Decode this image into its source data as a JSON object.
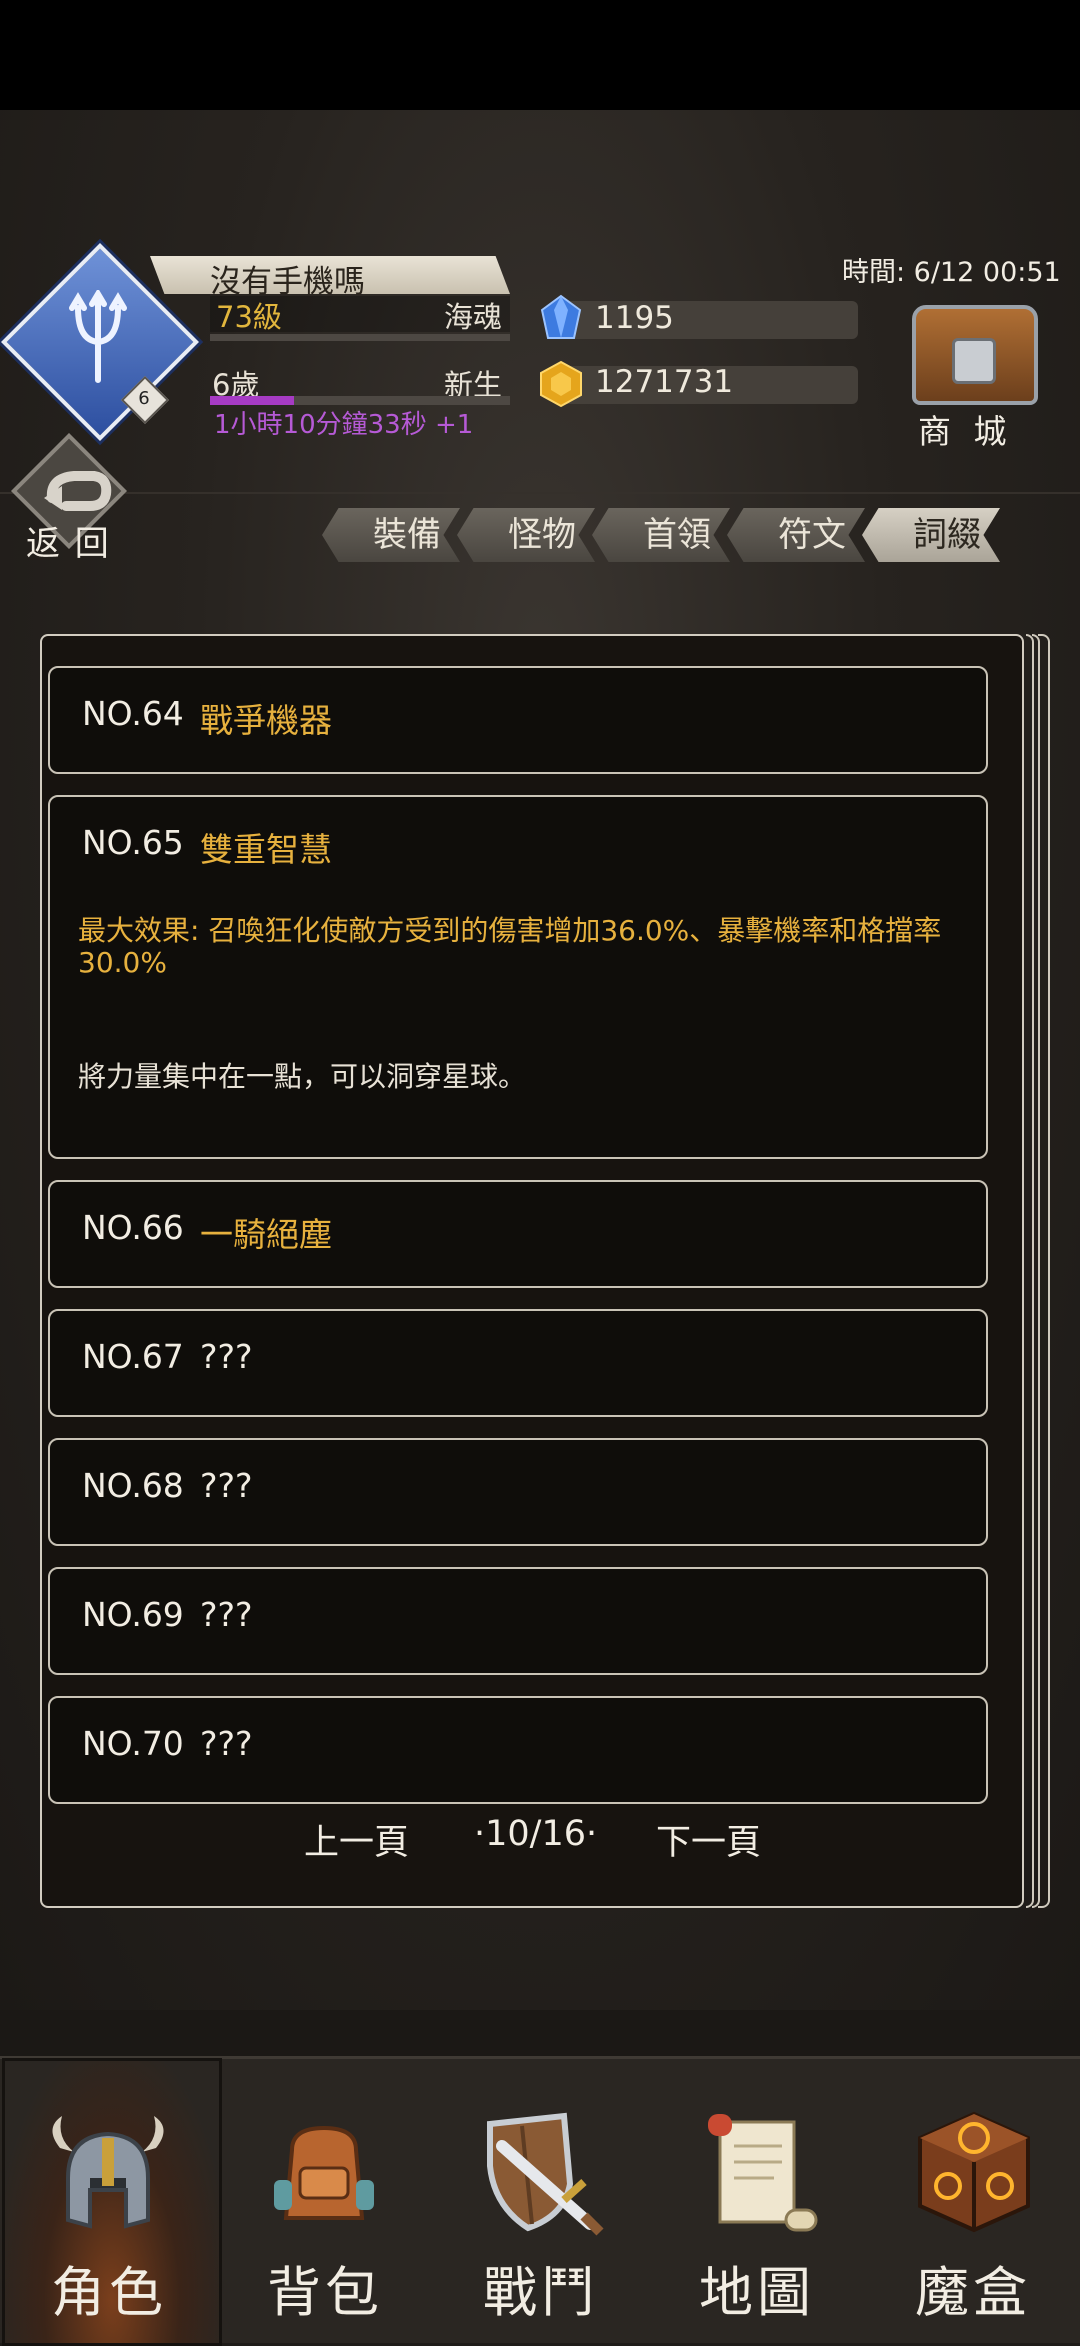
{
  "header": {
    "faint_title": "",
    "player_name": "沒有手機嗎",
    "level": "73級",
    "title": "海魂",
    "age": "6歲",
    "stage": "新生",
    "age_progress": 0.28,
    "timer": "1小時10分鐘33秒 +1",
    "avatar_level": "6",
    "clock": "時間: 6/12 00:51",
    "gems": "1195",
    "gold": "1271731",
    "shop_label": "商 城",
    "back_label": "返 回"
  },
  "tabs": [
    {
      "label": "裝備",
      "active": false
    },
    {
      "label": "怪物",
      "active": false
    },
    {
      "label": "首領",
      "active": false
    },
    {
      "label": "符文",
      "active": false
    },
    {
      "label": "詞綴",
      "active": true
    }
  ],
  "entries": [
    {
      "no": "NO.64",
      "name": "戰爭機器"
    },
    {
      "no": "NO.65",
      "name": "雙重智慧",
      "effect": "最大效果: 召喚狂化使敵方受到的傷害增加36.0%、暴擊機率和格擋率30.0%",
      "flavor": "將力量集中在一點，可以洞穿星球。"
    },
    {
      "no": "NO.66",
      "name": "一騎絕塵"
    },
    {
      "no": "NO.67",
      "name": "???"
    },
    {
      "no": "NO.68",
      "name": "???"
    },
    {
      "no": "NO.69",
      "name": "???"
    },
    {
      "no": "NO.70",
      "name": "???"
    }
  ],
  "pager": {
    "prev": "上一頁",
    "page": "·10/16·",
    "next": "下一頁"
  },
  "nav": [
    {
      "label": "角色",
      "icon": "helmet-icon",
      "active": true
    },
    {
      "label": "背包",
      "icon": "backpack-icon",
      "active": false
    },
    {
      "label": "戰鬥",
      "icon": "sword-shield-icon",
      "active": false
    },
    {
      "label": "地圖",
      "icon": "scroll-map-icon",
      "active": false
    },
    {
      "label": "魔盒",
      "icon": "magic-box-icon",
      "active": false
    }
  ],
  "colors": {
    "accent_gold": "#e7b13e",
    "timer_purple": "#b65ad6",
    "background": "#1f1c19"
  }
}
